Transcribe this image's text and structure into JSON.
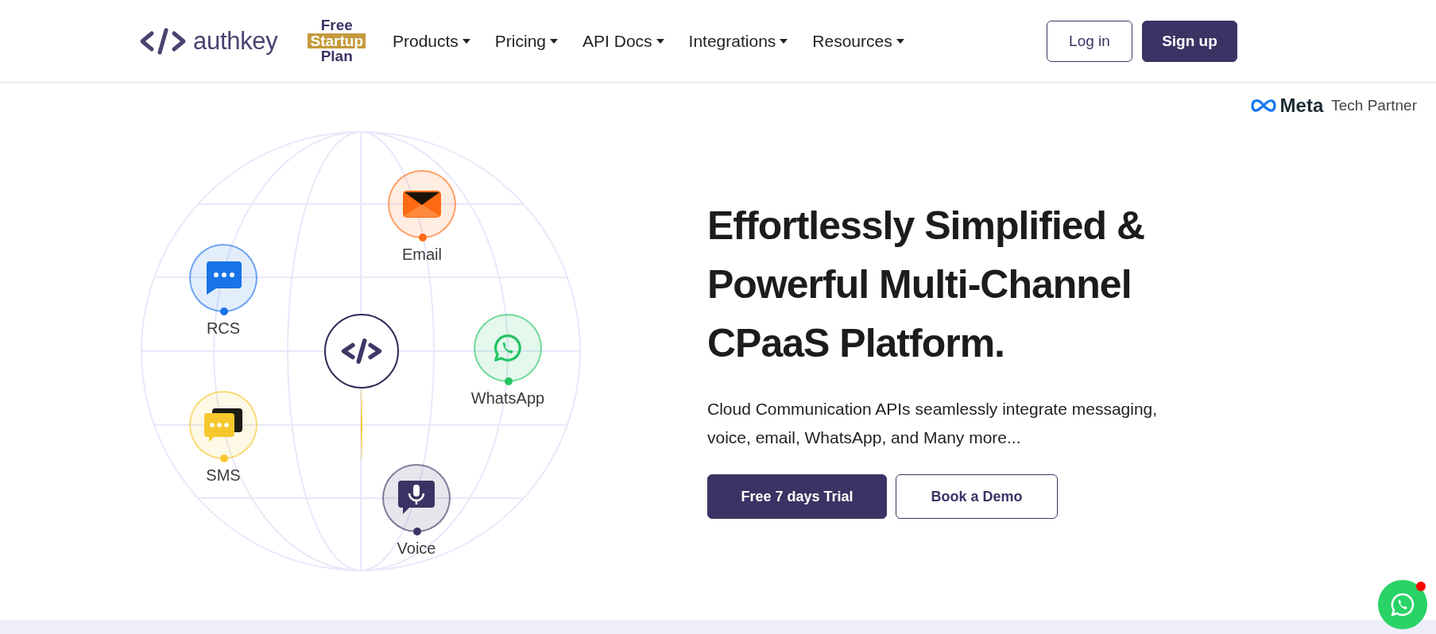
{
  "header": {
    "logo_text": "authkey",
    "promo": [
      "Free",
      "Startup",
      "Plan"
    ],
    "nav": [
      {
        "label": "Products",
        "dropdown": true
      },
      {
        "label": "Pricing",
        "dropdown": true
      },
      {
        "label": "API Docs",
        "dropdown": true
      },
      {
        "label": "Integrations",
        "dropdown": true
      },
      {
        "label": "Resources",
        "dropdown": true
      }
    ],
    "buttons": [
      {
        "label": "Log in",
        "kind": "outline"
      },
      {
        "label": "Sign up",
        "kind": "filled"
      }
    ]
  },
  "partner": {
    "brand": "Meta",
    "label": "Tech Partner"
  },
  "channels": [
    {
      "label": "Email",
      "kind": "email",
      "color": "#ff6a13"
    },
    {
      "label": "RCS",
      "kind": "rcs",
      "color": "#1a73e8"
    },
    {
      "label": "WhatsApp",
      "kind": "whatsapp",
      "color": "#25c463"
    },
    {
      "label": "SMS",
      "kind": "sms",
      "color": "#f7c72e"
    },
    {
      "label": "Voice",
      "kind": "voice",
      "color": "#3b3363"
    }
  ],
  "hero": {
    "heading": [
      "Effortlessly Simplified &",
      "Powerful Multi-Channel",
      "CPaaS Platform."
    ],
    "text": [
      "Cloud Communication APIs seamlessly integrate messaging,",
      "voice, email, WhatsApp, and Many more..."
    ],
    "buttons": [
      {
        "label": "Free 7 days Trial",
        "kind": "filled"
      },
      {
        "label": "Book a Demo",
        "kind": "outline"
      }
    ]
  }
}
